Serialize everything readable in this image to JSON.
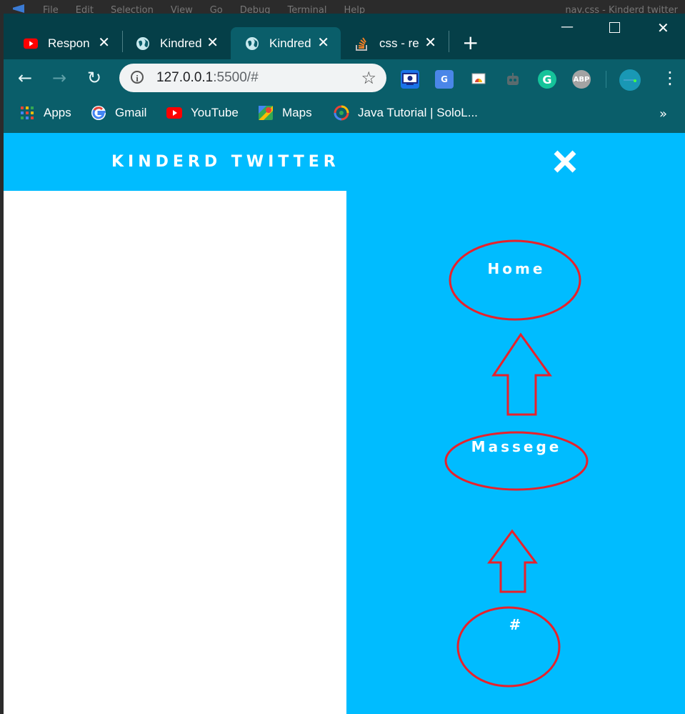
{
  "os": {
    "menu": [
      "File",
      "Edit",
      "Selection",
      "View",
      "Go",
      "Debug",
      "Terminal",
      "Help"
    ],
    "right_text": "nav.css - Kinderd twitter"
  },
  "browser": {
    "tabs": [
      {
        "title": "Respon",
        "icon": "youtube-icon",
        "active": false
      },
      {
        "title": "Kindred",
        "icon": "globe-icon",
        "active": false
      },
      {
        "title": "Kindred",
        "icon": "globe-icon",
        "active": true
      },
      {
        "title": "css - re",
        "icon": "stackoverflow-icon",
        "active": false
      }
    ],
    "new_tab": "+",
    "url_host": "127.0.0.1",
    "url_rest": ":5500/#",
    "bookmarks": [
      {
        "label": "Apps",
        "icon": "apps-grid-icon"
      },
      {
        "label": "Gmail",
        "icon": "google-icon"
      },
      {
        "label": "YouTube",
        "icon": "youtube-icon"
      },
      {
        "label": "Maps",
        "icon": "maps-icon"
      },
      {
        "label": "Java Tutorial | SoloL...",
        "icon": "sololearn-icon"
      }
    ],
    "bookmarks_overflow": "»",
    "extensions": [
      "screen-capture-icon",
      "google-translate-icon",
      "slides-icon",
      "robot-icon",
      "grammarly-icon",
      "adblock-plus-icon",
      "profile-icon"
    ],
    "ext_text": {
      "grammarly": "G",
      "abp": "ABP"
    }
  },
  "page": {
    "site_title": "KINDERD TWITTER",
    "nav": {
      "home": "Home",
      "message": "Massege",
      "hash": "#"
    },
    "colors": {
      "background": "#00bcff",
      "panel": "#ffffff",
      "annotation": "#e8212b"
    }
  }
}
